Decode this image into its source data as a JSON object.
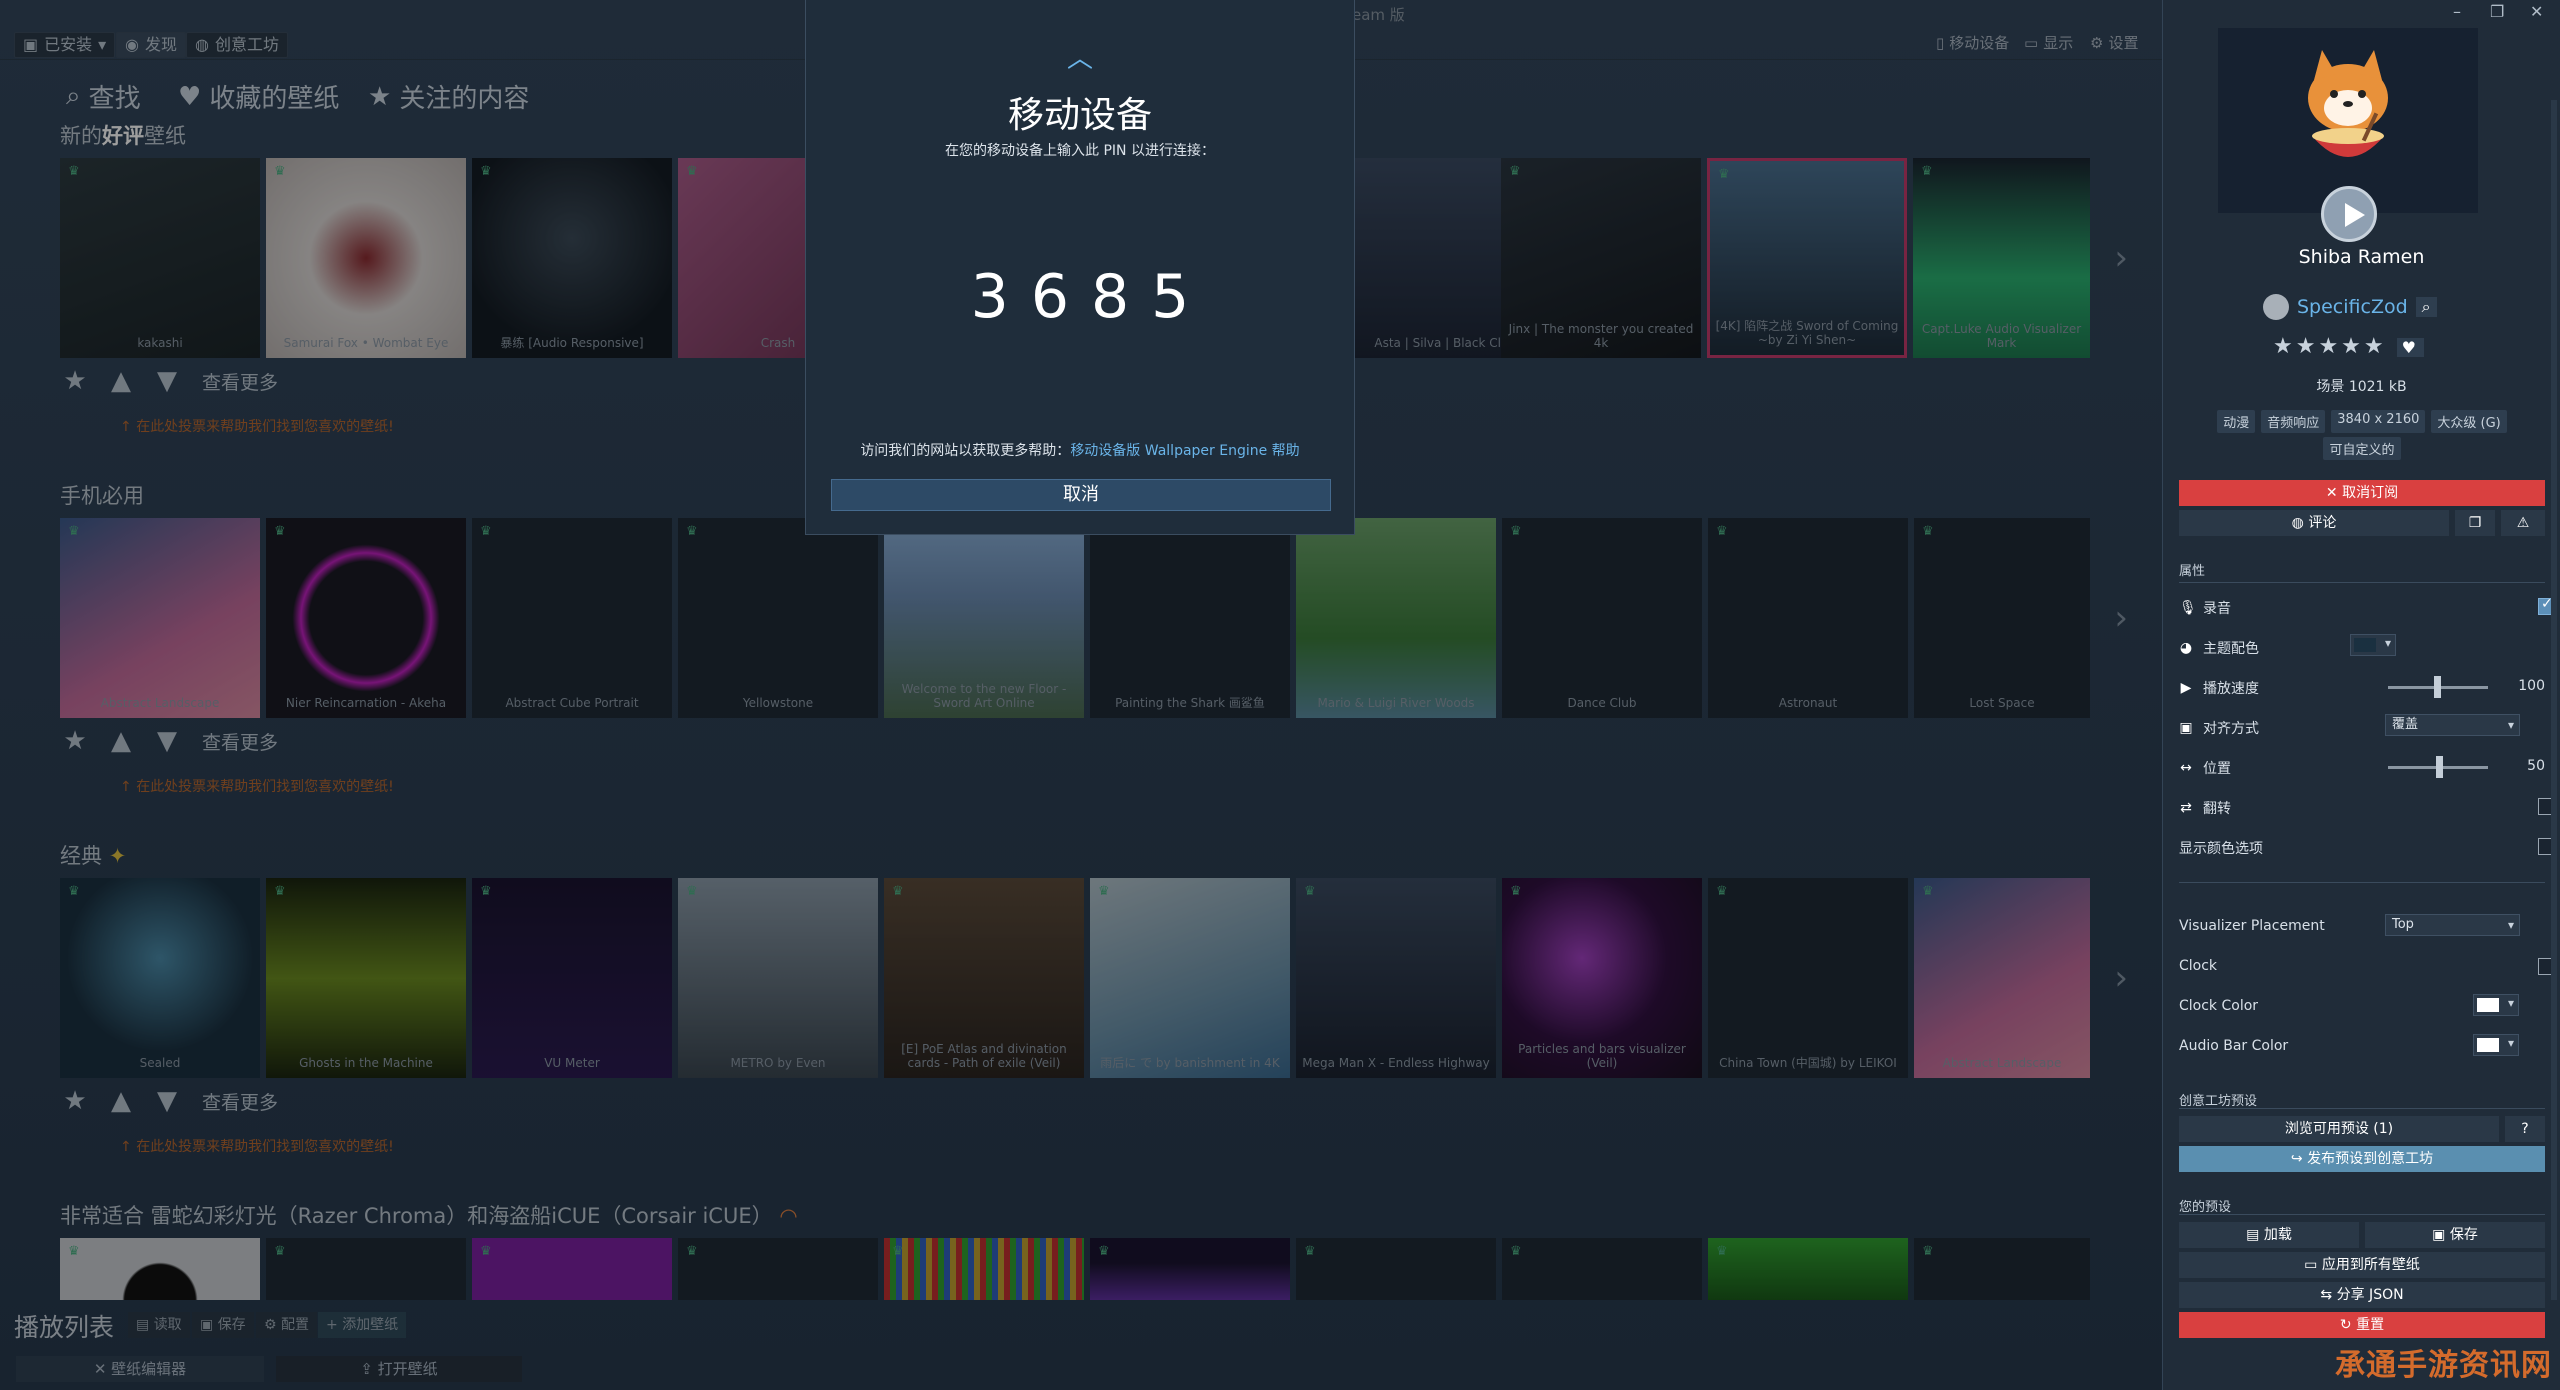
{
  "topbar": {
    "installed": "已安装",
    "discover": "发现",
    "workshop": "创意工坊",
    "app_title": "eam 版",
    "mobile": "移动设备",
    "display": "显示",
    "settings": "设置"
  },
  "nav": {
    "search": "查找",
    "favorites": "收藏的壁纸",
    "following": "关注的内容"
  },
  "sections": [
    {
      "title_prefix": "新的",
      "title_bold": "好评",
      "title_suffix": "壁纸",
      "tiles": [
        "kakashi",
        "Samurai Fox • Wombat Eye",
        "暴练 [Audio Responsive]",
        "Crash",
        "",
        "",
        "",
        "Asta | Silva | Black Clover |",
        "Jinx | The monster you created 4k",
        "[4K] 陷阵之战 Sword of Coming ~by Zi Yi Shen~",
        "Capt.Luke Audio Visualizer Mark"
      ]
    },
    {
      "title": "手机必用",
      "tiles": [
        "Abstract Landscape",
        "Nier Reincarnation - Akeha",
        "Abstract Cube Portrait",
        "Yellowstone",
        "Welcome to the new Floor - Sword Art Online",
        "Painting the Shark 画鲨鱼",
        "Mario & Luigi River Woods",
        "Dance Club",
        "Astronaut",
        "Lost Space"
      ]
    },
    {
      "title": "经典",
      "tiles": [
        "Sealed",
        "Ghosts in the Machine",
        "VU Meter",
        "METRO by Even",
        "[E] PoE Atlas and divination cards - Path of exile (Veil)",
        "雨后に で by banishment in 4K",
        "Mega Man X - Endless Highway",
        "Particles and bars visualizer (Veil)",
        "China Town (中国城) by LEIKOI",
        "Abstract Landscape"
      ]
    },
    {
      "title": "非常适合 雷蛇幻彩灯光（Razer Chroma）和海盗船iCUE（Corsair iCUE）"
    }
  ],
  "actions": {
    "more": "查看更多",
    "hint": "在此处投票来帮助我们找到您喜欢的壁纸!"
  },
  "playlist": {
    "title": "播放列表",
    "load": "读取",
    "save": "保存",
    "config": "配置",
    "add": "添加壁纸",
    "editor": "壁纸编辑器",
    "open": "打开壁纸"
  },
  "modal": {
    "title": "移动设备",
    "subtitle": "在您的移动设备上输入此 PIN 以进行连接：",
    "pin": "3685",
    "help_prefix": "访问我们的网站以获取更多帮助：",
    "help_link": "移动设备版 Wallpaper Engine 帮助",
    "cancel": "取消"
  },
  "panel": {
    "name": "Shiba Ramen",
    "author": "SpecificZod",
    "rating": 5,
    "size": "场景 1021 kB",
    "tags": [
      "动漫",
      "音频响应",
      "3840 x 2160",
      "大众级 (G)",
      "可自定义的"
    ],
    "unsubscribe": "取消订阅",
    "comment": "评论",
    "properties_title": "属性",
    "props": {
      "audio": "录音",
      "scheme": "主题配色",
      "speed": "播放速度",
      "speed_val": "100",
      "align": "对齐方式",
      "align_val": "覆盖",
      "position": "位置",
      "position_val": "50",
      "flip": "翻转",
      "show_colors": "显示颜色选项"
    },
    "viz": {
      "placement": "Visualizer Placement",
      "placement_val": "Top",
      "clock": "Clock",
      "clock_color": "Clock Color",
      "audio_bar_color": "Audio Bar Color"
    },
    "workshop_title": "创意工坊预设",
    "browse": "浏览可用预设 (1)",
    "help": "?",
    "publish": "发布预设到创意工坊",
    "presets_title": "您的预设",
    "load": "加载",
    "save": "保存",
    "apply_all": "应用到所有壁纸",
    "share": "分享 JSON",
    "reset": "重置"
  },
  "colors": {
    "accent": "#6ab4e8",
    "danger": "#d94040",
    "orange": "#d46b2c"
  },
  "watermark": "承通手游资讯网"
}
